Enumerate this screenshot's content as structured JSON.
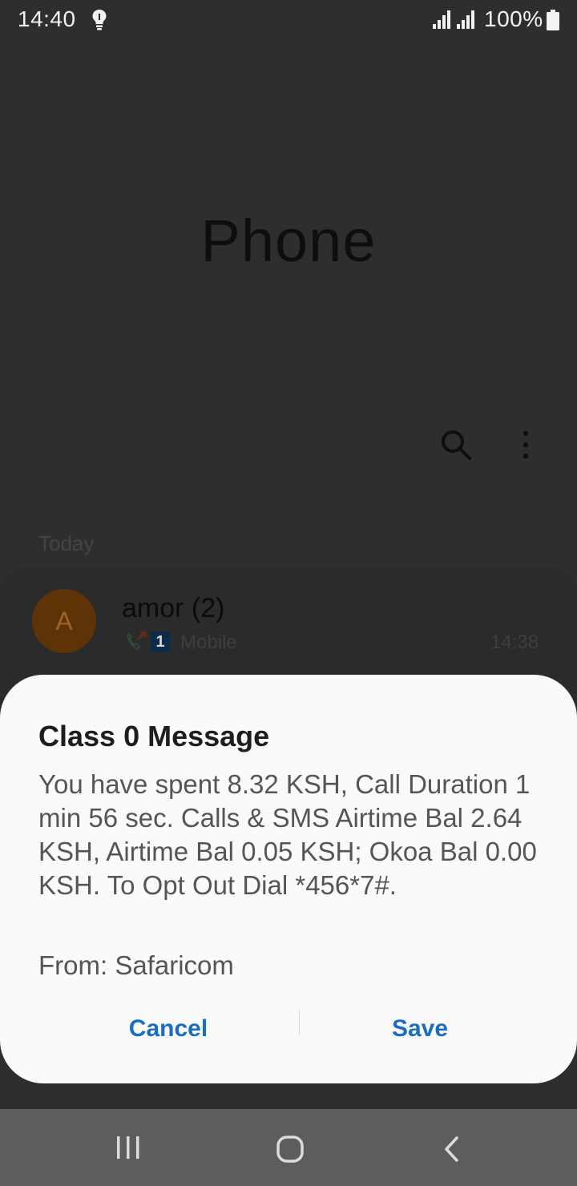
{
  "status_bar": {
    "time": "14:40",
    "battery_text": "100%",
    "icons": [
      "bulb-icon",
      "signal-icon",
      "signal-icon",
      "battery-icon"
    ]
  },
  "app": {
    "title": "Phone",
    "toolbar_icons": [
      "search-icon",
      "more-options-icon"
    ],
    "section_header": "Today",
    "recent_calls": [
      {
        "avatar_letter": "A",
        "avatar_color": "#5e3407",
        "name": "amor (2)",
        "sim": "1",
        "type": "Mobile",
        "time": "14:38",
        "call_icon": "outgoing-call-icon"
      }
    ]
  },
  "dialog": {
    "title": "Class 0 Message",
    "body": "You have spent 8.32 KSH, Call Duration 1 min 56 sec. Calls & SMS Airtime Bal 2.64 KSH, Airtime Bal 0.05 KSH; Okoa Bal 0.00 KSH. To Opt Out Dial *456*7#.",
    "from": "From: Safaricom",
    "cancel_label": "Cancel",
    "save_label": "Save",
    "accent_color": "#1b6dc1"
  },
  "nav_bar": {
    "icons": [
      "recent-apps-icon",
      "home-icon",
      "back-icon"
    ]
  }
}
